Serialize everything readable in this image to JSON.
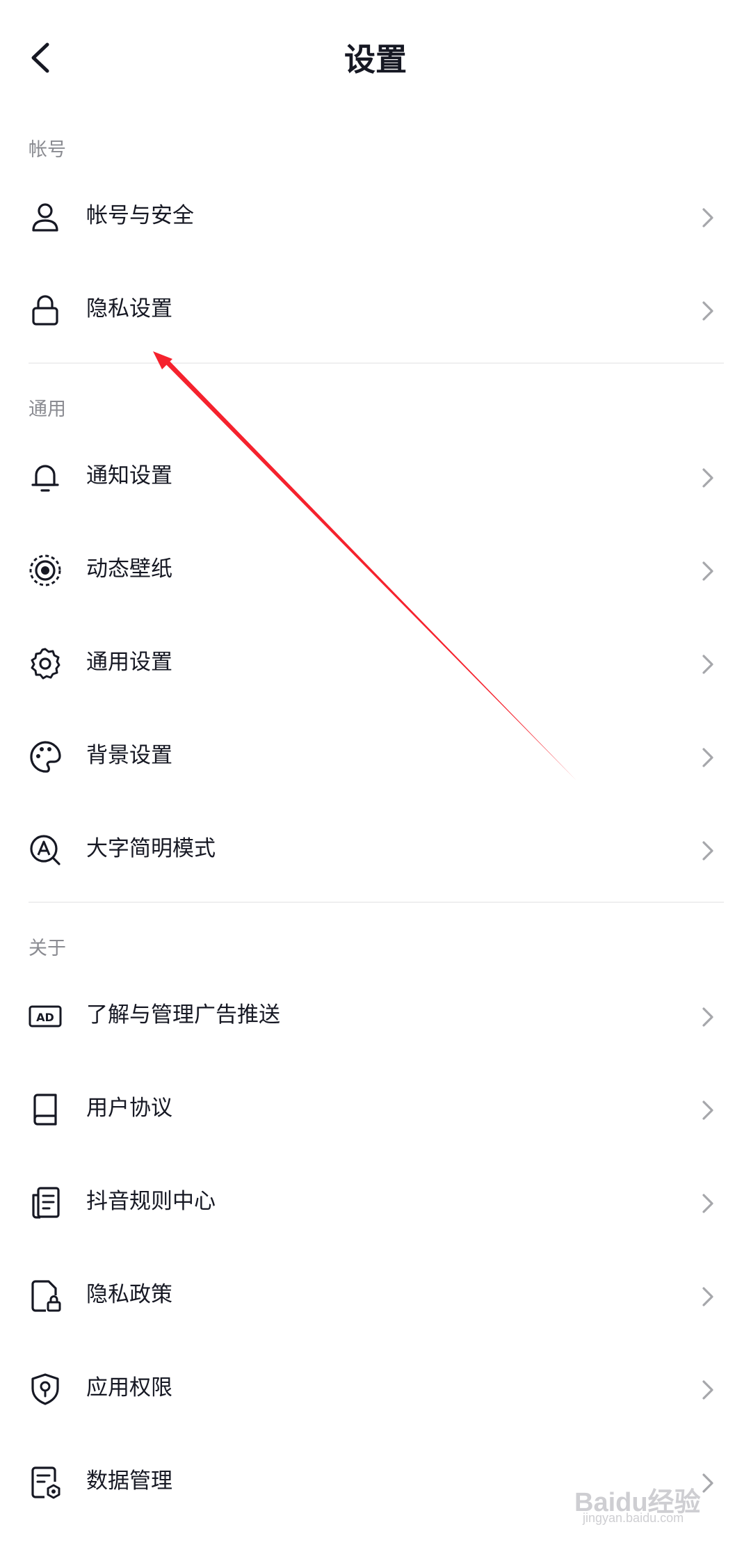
{
  "header": {
    "title": "设置",
    "back_icon": "chevron-left-icon"
  },
  "sections": {
    "account": {
      "label": "帐号",
      "items": [
        {
          "label": "帐号与安全",
          "icon": "user-icon"
        },
        {
          "label": "隐私设置",
          "icon": "lock-icon"
        }
      ]
    },
    "general": {
      "label": "通用",
      "items": [
        {
          "label": "通知设置",
          "icon": "bell-icon"
        },
        {
          "label": "动态壁纸",
          "icon": "live-wallpaper-icon"
        },
        {
          "label": "通用设置",
          "icon": "gear-icon"
        },
        {
          "label": "背景设置",
          "icon": "palette-icon"
        },
        {
          "label": "大字简明模式",
          "icon": "large-text-icon"
        }
      ]
    },
    "about": {
      "label": "关于",
      "items": [
        {
          "label": "了解与管理广告推送",
          "icon": "ad-icon"
        },
        {
          "label": "用户协议",
          "icon": "book-icon"
        },
        {
          "label": "抖音规则中心",
          "icon": "rules-document-icon"
        },
        {
          "label": "隐私政策",
          "icon": "privacy-policy-icon"
        },
        {
          "label": "应用权限",
          "icon": "shield-icon"
        },
        {
          "label": "数据管理",
          "icon": "data-settings-icon"
        }
      ]
    }
  },
  "colors": {
    "text": "#161823",
    "section_label": "#8a8b91",
    "chevron": "#a6a7ab",
    "divider": "#efeff0",
    "annotation_arrow": "#f5222d"
  },
  "watermark": {
    "text": "Baidu经验",
    "sub": "jingyan.baidu.com"
  }
}
